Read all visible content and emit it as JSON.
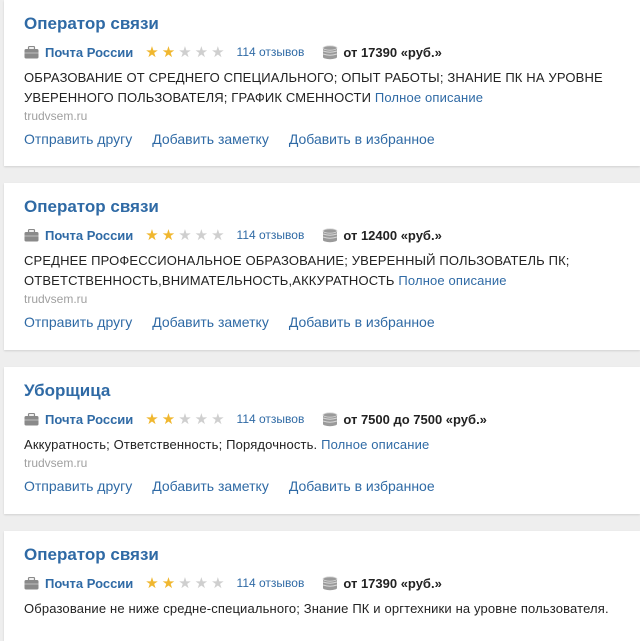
{
  "colors": {
    "link": "#2f6aa5",
    "star_on": "#f0b72f",
    "star_off": "#cfcfcf",
    "source": "#a0a0a0",
    "background": "#eeeeee"
  },
  "icons": {
    "company": "briefcase-icon",
    "salary": "coins-icon"
  },
  "vacancies": [
    {
      "title": "Оператор связи",
      "company": "Почта России",
      "rating": 2,
      "rating_max": 5,
      "reviews": "114 отзывов",
      "salary": "от 17390 «руб.»",
      "description": "ОБРАЗОВАНИЕ ОТ СРЕДНЕГО СПЕЦИАЛЬНОГО; ОПЫТ РАБОТЫ; ЗНАНИЕ ПК НА УРОВНЕ УВЕРЕННОГО ПОЛЬЗОВАТЕЛЯ; ГРАФИК СМЕННОСТИ",
      "more_link": "Полное описание",
      "source": "trudvsem.ru",
      "actions": [
        "Отправить другу",
        "Добавить заметку",
        "Добавить в избранное"
      ]
    },
    {
      "title": "Оператор связи",
      "company": "Почта России",
      "rating": 2,
      "rating_max": 5,
      "reviews": "114 отзывов",
      "salary": "от 12400 «руб.»",
      "description": "СРЕДНЕЕ ПРОФЕССИОНАЛЬНОЕ ОБРАЗОВАНИЕ; УВЕРЕННЫЙ ПОЛЬЗОВАТЕЛЬ ПК; ОТВЕТСТВЕННОСТЬ,ВНИМАТЕЛЬНОСТЬ,АККУРАТНОСТЬ",
      "more_link": "Полное описание",
      "source": "trudvsem.ru",
      "actions": [
        "Отправить другу",
        "Добавить заметку",
        "Добавить в избранное"
      ]
    },
    {
      "title": "Уборщица",
      "company": "Почта России",
      "rating": 2,
      "rating_max": 5,
      "reviews": "114 отзывов",
      "salary": "от 7500 до 7500 «руб.»",
      "description": "Аккуратность; Ответственность; Порядочность.",
      "more_link": "Полное описание",
      "source": "trudvsem.ru",
      "actions": [
        "Отправить другу",
        "Добавить заметку",
        "Добавить в избранное"
      ]
    },
    {
      "title": "Оператор связи",
      "company": "Почта России",
      "rating": 2,
      "rating_max": 5,
      "reviews": "114 отзывов",
      "salary": "от 17390 «руб.»",
      "description": "Образование не ниже средне-специального; Знание ПК и оргтехники на уровне пользователя.",
      "more_link": "",
      "source": "",
      "actions": []
    }
  ]
}
